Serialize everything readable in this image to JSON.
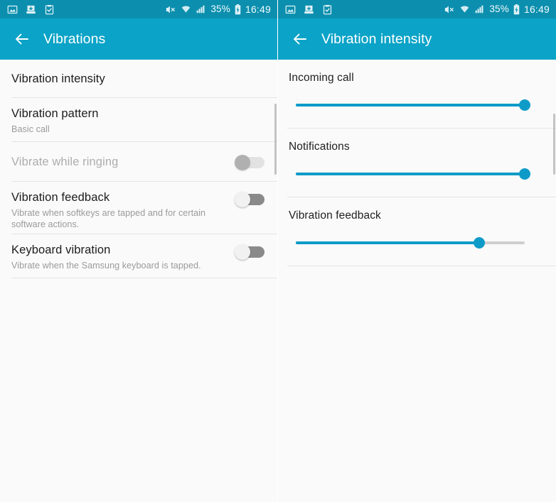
{
  "statusbar": {
    "left_icons": [
      "image-icon",
      "save-icon",
      "clipboard-check-icon"
    ],
    "right_icons": [
      "mute-icon",
      "wifi-icon",
      "signal-icon",
      "battery-charging-icon"
    ],
    "battery_text": "35%",
    "time": "16:49"
  },
  "colors": {
    "statusbar_bg": "#0c8fae",
    "appbar_bg": "#0ba3c7",
    "accent_slider": "#0e9bc8",
    "page_bg": "#fafafa",
    "divider": "#e4e4e4",
    "toggle_off_track": "#8a8a8a",
    "toggle_disabled_track": "#e2e2e2"
  },
  "left_screen": {
    "title": "Vibrations",
    "back_icon": "arrow-left-icon",
    "rows": [
      {
        "name": "vibration-intensity",
        "title": "Vibration intensity",
        "subtitle": "",
        "control": "none",
        "disabled": false
      },
      {
        "name": "vibration-pattern",
        "title": "Vibration pattern",
        "subtitle": "Basic call",
        "control": "none",
        "disabled": false
      },
      {
        "name": "vibrate-while-ringing",
        "title": "Vibrate while ringing",
        "subtitle": "",
        "control": "toggle",
        "toggle_state": "off",
        "disabled": true
      },
      {
        "name": "vibration-feedback",
        "title": "Vibration feedback",
        "subtitle": "Vibrate when softkeys are tapped and for certain software actions.",
        "control": "toggle",
        "toggle_state": "off",
        "disabled": false
      },
      {
        "name": "keyboard-vibration",
        "title": "Keyboard vibration",
        "subtitle": "Vibrate when the Samsung keyboard is tapped.",
        "control": "toggle",
        "toggle_state": "off",
        "disabled": false
      }
    ]
  },
  "right_screen": {
    "title": "Vibration intensity",
    "back_icon": "arrow-left-icon",
    "sliders": [
      {
        "name": "incoming-call",
        "label": "Incoming call",
        "value": 100
      },
      {
        "name": "notifications",
        "label": "Notifications",
        "value": 100
      },
      {
        "name": "vibration-feedback",
        "label": "Vibration feedback",
        "value": 80
      }
    ]
  }
}
